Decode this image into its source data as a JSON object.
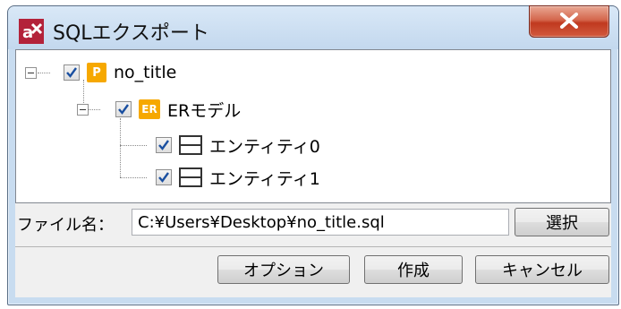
{
  "window": {
    "title": "SQLエクスポート"
  },
  "tree": {
    "root": {
      "label": "no_title",
      "icon": "P",
      "checked": true
    },
    "model": {
      "label": "ERモデル",
      "icon": "ER",
      "checked": true
    },
    "entities": [
      {
        "label": "エンティティ0",
        "checked": true
      },
      {
        "label": "エンティティ1",
        "checked": true
      }
    ]
  },
  "file": {
    "label": "ファイル名：",
    "value": "C:¥Users¥Desktop¥no_title.sql",
    "select_label": "選択"
  },
  "buttons": {
    "options": "オプション",
    "create": "作成",
    "cancel": "キャンセル"
  },
  "colors": {
    "accent": "#f6a800",
    "close": "#c0391f"
  }
}
